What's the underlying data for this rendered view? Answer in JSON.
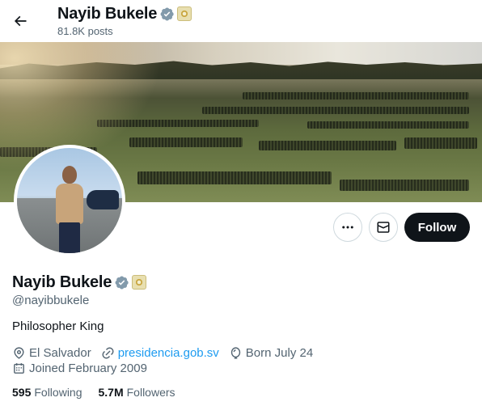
{
  "header": {
    "back_icon": "arrow-left-icon",
    "name": "Nayib Bukele",
    "posts": "81.8K posts"
  },
  "profile": {
    "name": "Nayib Bukele",
    "handle": "@nayibbukele",
    "bio": "Philosopher King",
    "location": "El Salvador",
    "website": "presidencia.gob.sv",
    "birthday": "Born July 24",
    "joined": "Joined February 2009",
    "following_count": "595",
    "following_label": "Following",
    "followers_count": "5.7M",
    "followers_label": "Followers"
  },
  "actions": {
    "more_icon": "more-dots-icon",
    "message_icon": "envelope-icon",
    "follow_label": "Follow"
  },
  "colors": {
    "verified_blue": "#1d9bf0",
    "link_blue": "#1d9bf0",
    "follow_button": "#0f1419",
    "secondary_text": "#536471"
  }
}
